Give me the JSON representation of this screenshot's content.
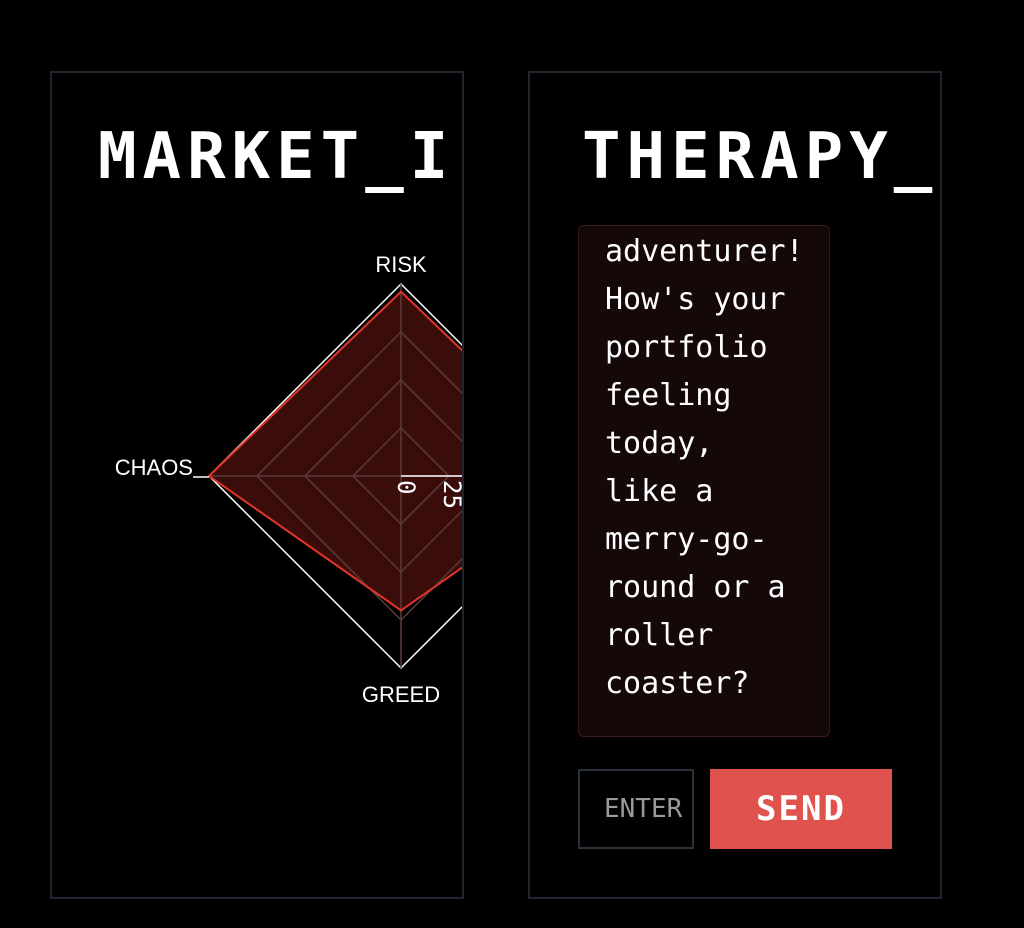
{
  "market_panel": {
    "title": "MARKET_I"
  },
  "therapy_panel": {
    "title": "THERAPY_",
    "chat": {
      "message": "adventurer!\nHow's your\nportfolio\nfeeling\ntoday,\nlike a\nmerry-go-\nround or a\nroller\ncoaster?"
    },
    "input": {
      "placeholder": "ENTER"
    },
    "send_label": "SEND"
  },
  "chart_data": {
    "type": "radar",
    "axes": [
      "RISK",
      "",
      "GREED",
      "CHAOS"
    ],
    "visible_axis_labels": [
      "RISK",
      "GREED",
      "CHAOS"
    ],
    "max": 100,
    "rings": 4,
    "tick_labels": [
      "0",
      "25"
    ],
    "series": [
      {
        "values": [
          96,
          100,
          70,
          100
        ],
        "color": "#e0352b",
        "fill": "#3a0d0b"
      }
    ],
    "grid_color": "#5a3b38",
    "outer_color": "#ffffff"
  }
}
